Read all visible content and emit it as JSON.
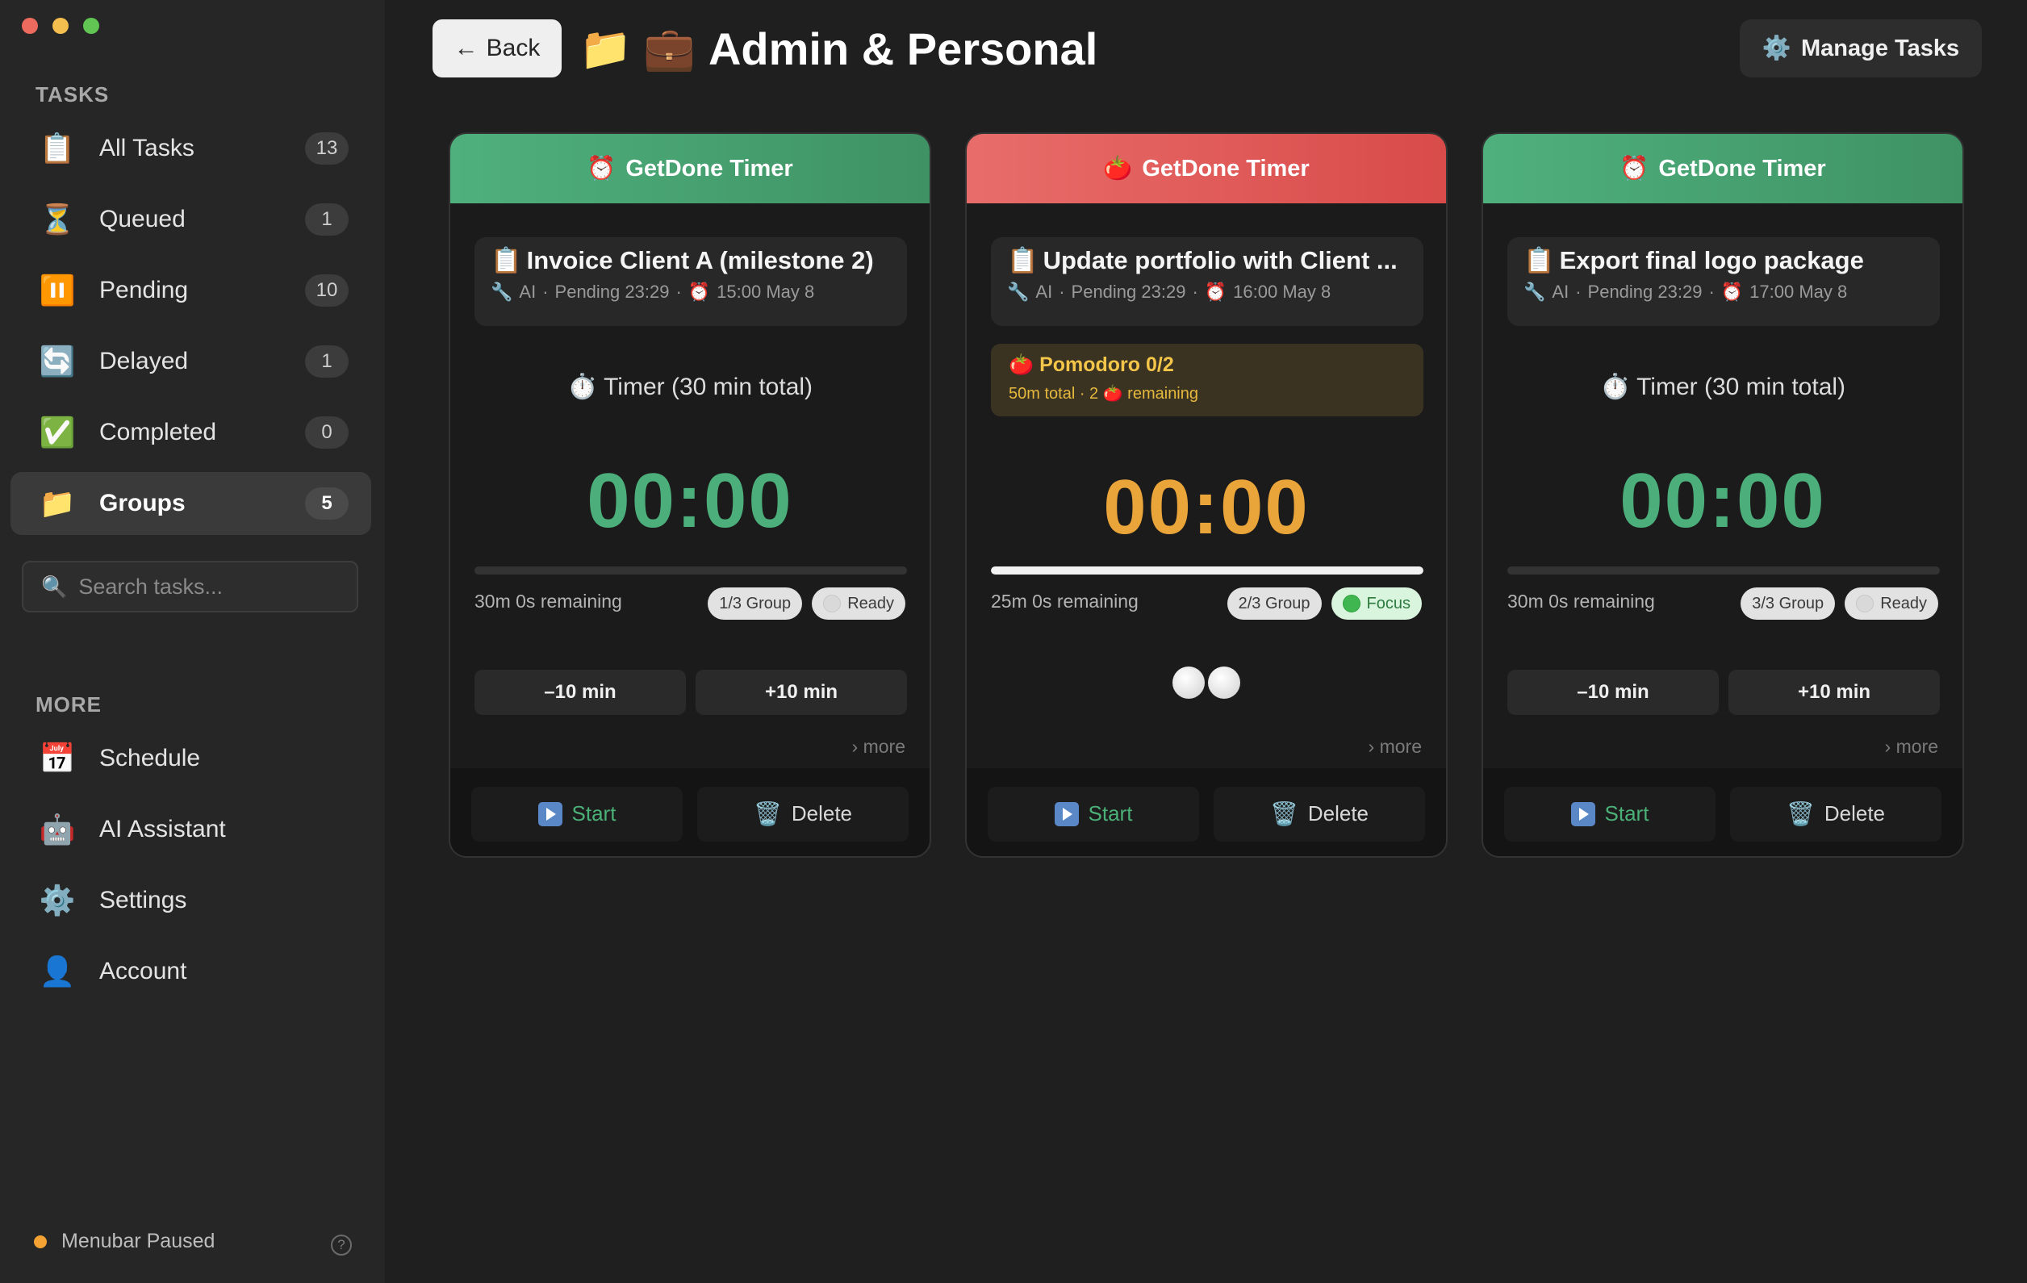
{
  "window": {
    "controls": [
      "close",
      "minimize",
      "zoom"
    ]
  },
  "sidebar": {
    "tasks_section_label": "TASKS",
    "items": [
      {
        "label": "All Tasks",
        "count": "13",
        "icon": "clipboard-icon",
        "glyph": "📋"
      },
      {
        "label": "Queued",
        "count": "1",
        "icon": "hourglass-icon",
        "glyph": "⏳"
      },
      {
        "label": "Pending",
        "count": "10",
        "icon": "pause-icon",
        "glyph": "⏸️"
      },
      {
        "label": "Delayed",
        "count": "1",
        "icon": "refresh-icon",
        "glyph": "🔄"
      },
      {
        "label": "Completed",
        "count": "0",
        "icon": "check-icon",
        "glyph": "✅"
      },
      {
        "label": "Groups",
        "count": "5",
        "icon": "folder-icon",
        "glyph": "📁",
        "active": true
      }
    ],
    "search": {
      "placeholder": "Search tasks...",
      "value": "",
      "icon": "search-icon"
    },
    "more_section_label": "MORE",
    "more_items": [
      {
        "label": "Schedule",
        "icon": "calendar-icon",
        "glyph": "📅"
      },
      {
        "label": "AI Assistant",
        "icon": "robot-icon",
        "glyph": "🤖"
      },
      {
        "label": "Settings",
        "icon": "gear-icon",
        "glyph": "⚙️"
      },
      {
        "label": "Account",
        "icon": "user-icon",
        "glyph": "👤"
      }
    ],
    "status": {
      "text": "Menubar Paused",
      "dot_color": "#f3a233",
      "help": "?"
    }
  },
  "header": {
    "back_label": "Back",
    "back_arrow": "←",
    "title_icons": "📁 💼",
    "title": "Admin & Personal",
    "manage_label": "Manage Tasks",
    "manage_icon": "⚙️"
  },
  "cards": [
    {
      "header_label": "GetDone Timer",
      "header_icon": "⏰",
      "header_color": "#4fb07d",
      "task_icon": "📋",
      "task_title": "Invoice Client A (milestone 2)",
      "meta_icon": "🔧",
      "meta_source": "AI",
      "meta_status": "Pending 23:29",
      "meta_due_icon": "⏰",
      "meta_due": "15:00 May 8",
      "timer_label": "⏱️ Timer (30 min total)",
      "time": "00:00",
      "progress": 0,
      "remaining": "30m 0s remaining",
      "group_badge": "1/3 Group",
      "state_badge": "Ready",
      "minus_label": "–10 min",
      "plus_label": "+10 min",
      "more_label": "› more",
      "start_label": "Start",
      "delete_label": "Delete"
    },
    {
      "header_label": "GetDone Timer",
      "header_icon": "🍅",
      "header_color": "#e0605e",
      "task_icon": "📋",
      "task_title": "Update portfolio with Client ...",
      "meta_icon": "🔧",
      "meta_source": "AI",
      "meta_status": "Pending 23:29",
      "meta_due_icon": "⏰",
      "meta_due": "16:00 May 8",
      "pomodoro_title": "🍅 Pomodoro 0/2",
      "pomodoro_sub": "50m total · 2 🍅 remaining",
      "time": "00:00",
      "progress": 1,
      "remaining": "25m 0s remaining",
      "group_badge": "2/3 Group",
      "state_badge": "Focus",
      "pomodoro_dots": 2,
      "more_label": "› more",
      "start_label": "Start",
      "delete_label": "Delete"
    },
    {
      "header_label": "GetDone Timer",
      "header_icon": "⏰",
      "header_color": "#4fb07d",
      "task_icon": "📋",
      "task_title": "Export final logo package",
      "meta_icon": "🔧",
      "meta_source": "AI",
      "meta_status": "Pending 23:29",
      "meta_due_icon": "⏰",
      "meta_due": "17:00 May 8",
      "timer_label": "⏱️ Timer (30 min total)",
      "time": "00:00",
      "progress": 0,
      "remaining": "30m 0s remaining",
      "group_badge": "3/3 Group",
      "state_badge": "Ready",
      "minus_label": "–10 min",
      "plus_label": "+10 min",
      "more_label": "› more",
      "start_label": "Start",
      "delete_label": "Delete"
    }
  ]
}
